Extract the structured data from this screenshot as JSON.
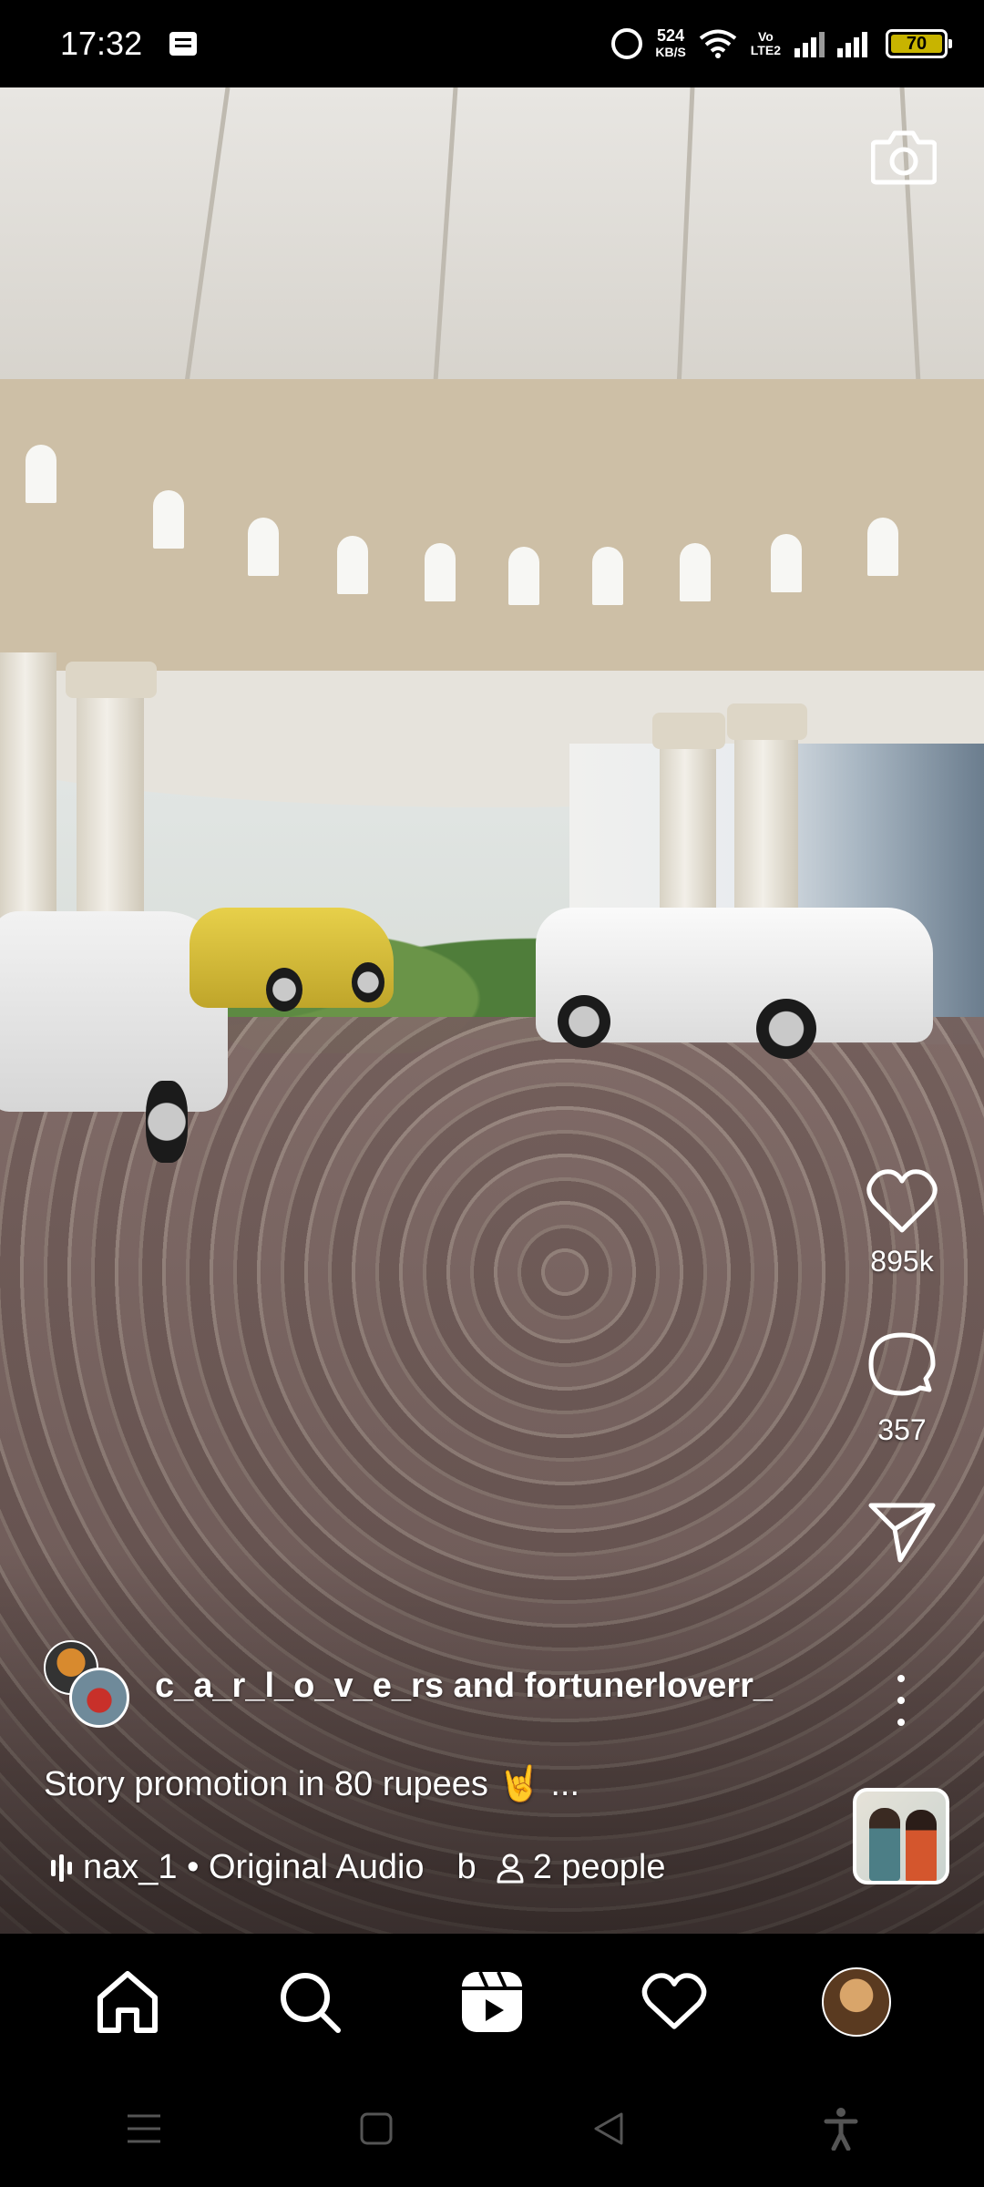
{
  "status_bar": {
    "time": "17:32",
    "net_speed_value": "524",
    "net_speed_unit": "KB/S",
    "volte_top": "Vo",
    "volte_bottom": "LTE2",
    "battery_level": "70",
    "icons": [
      "message-icon",
      "alarm-icon",
      "wifi-icon",
      "volte-icon",
      "signal-icon",
      "signal-icon",
      "battery-icon"
    ]
  },
  "reel": {
    "likes": "895k",
    "comments": "357",
    "author": "c_a_r_l_o_v_e_rs and fortunerloverr_",
    "caption": "Story promotion in 80 rupees 🤘 ...",
    "audio": "nax_1 • Original Audio",
    "audio_extra": "b",
    "people": "2 people"
  },
  "bottom_nav": {
    "items": [
      "home-icon",
      "search-icon",
      "reels-icon",
      "activity-heart-icon",
      "profile-avatar"
    ]
  },
  "system_nav": {
    "items": [
      "menu-icon",
      "home-square-icon",
      "back-icon",
      "accessibility-icon"
    ]
  },
  "colors": {
    "background": "#000000",
    "battery": "#c8b400",
    "icon": "#ffffff"
  }
}
